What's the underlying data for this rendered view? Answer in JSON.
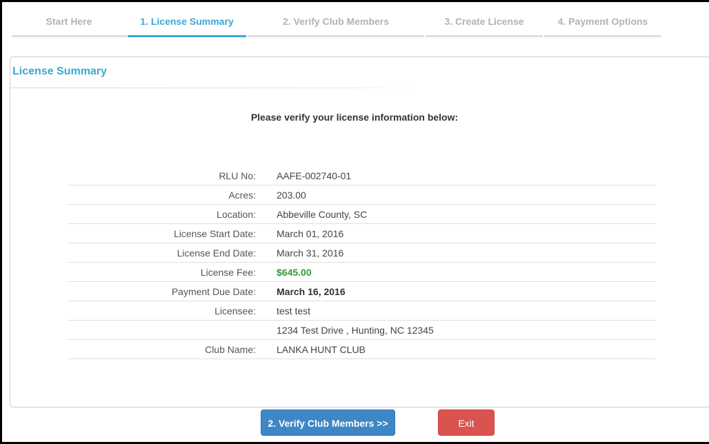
{
  "steps": [
    {
      "label": "Start Here",
      "active": false
    },
    {
      "label": "1. License Summary",
      "active": true
    },
    {
      "label": "2. Verify Club Members",
      "active": false
    },
    {
      "label": "3. Create License",
      "active": false
    },
    {
      "label": "4. Payment Options",
      "active": false
    }
  ],
  "panel": {
    "title": "License Summary",
    "intro": "Please verify your license information below:"
  },
  "info": {
    "rows": [
      {
        "label": "RLU No:",
        "value": "AAFE-002740-01"
      },
      {
        "label": "Acres:",
        "value": "203.00"
      },
      {
        "label": "Location:",
        "value": "Abbeville County, SC"
      },
      {
        "label": "License Start Date:",
        "value": "March 01, 2016"
      },
      {
        "label": "License End Date:",
        "value": "March 31, 2016"
      },
      {
        "label": "License Fee:",
        "value": "$645.00"
      },
      {
        "label": "Payment Due Date:",
        "value": "March 16, 2016"
      },
      {
        "label": "Licensee:",
        "value": "test test"
      },
      {
        "label": "",
        "value": "1234 Test Drive , Hunting, NC 12345"
      },
      {
        "label": "Club Name:",
        "value": "LANKA HUNT CLUB"
      }
    ]
  },
  "buttons": {
    "next_label": "2. Verify Club Members >>",
    "exit_label": "Exit"
  },
  "colors": {
    "accent": "#3aa8d4",
    "fee": "#2f9a3a",
    "next_button": "#3d87c6",
    "exit_button": "#d9534f"
  }
}
